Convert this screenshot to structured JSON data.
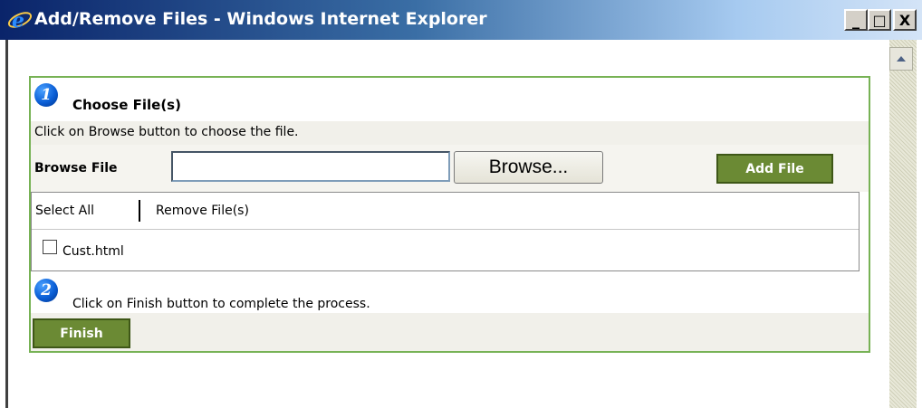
{
  "window": {
    "title": "Add/Remove Files - Windows Internet Explorer",
    "icon": "ie-logo-icon"
  },
  "controls": {
    "minimize": "_",
    "maximize": "□",
    "close": "X"
  },
  "step1": {
    "number": "1",
    "title": "Choose File(s)",
    "instruction": "Click on Browse button to choose the file."
  },
  "browse": {
    "label": "Browse File",
    "input_value": "",
    "button_label": "Browse...",
    "add_label": "Add File"
  },
  "files": {
    "select_all": "Select All",
    "remove": "Remove File(s)",
    "items": [
      {
        "name": "Cust.html",
        "checked": false
      }
    ]
  },
  "step2": {
    "number": "2",
    "instruction": "Click on Finish button to complete the process.",
    "finish_label": "Finish"
  },
  "colors": {
    "accent_green": "#6b8a34",
    "panel_border": "#77b255",
    "title_bar": "#0a246a"
  }
}
